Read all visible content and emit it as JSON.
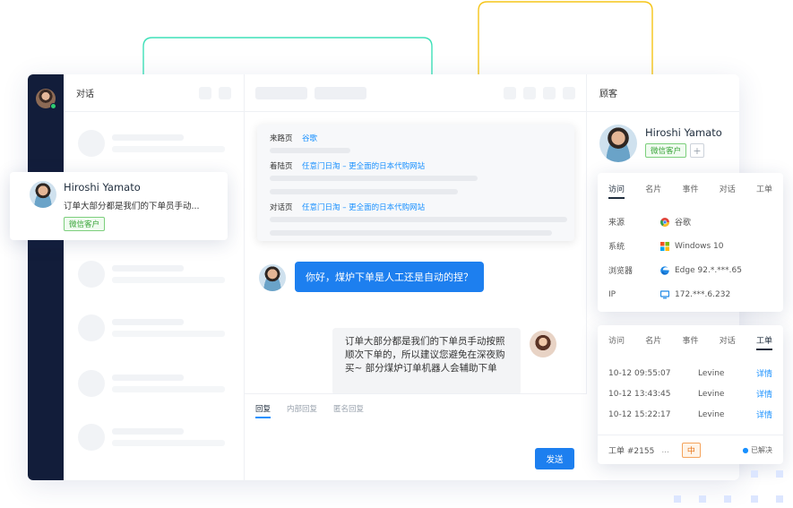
{
  "conversation_panel": {
    "title": "对话"
  },
  "customer_panel": {
    "title": "顾客"
  },
  "customer": {
    "name": "Hiroshi Yamato",
    "tag": "微信客户",
    "add": "+"
  },
  "popup_card": {
    "name": "Hiroshi Yamato",
    "preview": "订单大部分都是我们的下单员手动...",
    "tag": "微信客户"
  },
  "visit_info": {
    "rows": [
      {
        "label": "来路页",
        "value": "谷歌"
      },
      {
        "label": "着陆页",
        "value": "任意门日淘 – 更全面的日本代购网站"
      },
      {
        "label": "对话页",
        "value": "任意门日淘 – 更全面的日本代购网站"
      }
    ]
  },
  "messages": {
    "incoming": "你好，煤炉下单是人工还是自动的捏？",
    "outgoing": "订单大部分都是我们的下单员手动按照顺次下单的，所以建议您避免在深夜购买~ 部分煤炉订单机器人会辅助下单"
  },
  "composer": {
    "tabs": [
      "回复",
      "内部回复",
      "匿名回复"
    ],
    "send": "发送"
  },
  "visit_card": {
    "tabs": [
      "访问",
      "名片",
      "事件",
      "对话",
      "工单"
    ],
    "rows": [
      {
        "label": "来源",
        "value": "谷歌",
        "icon": "chrome-icon"
      },
      {
        "label": "系统",
        "value": "Windows 10",
        "icon": "windows-icon"
      },
      {
        "label": "浏览器",
        "value": "Edge 92.*.***.65",
        "icon": "edge-icon"
      },
      {
        "label": "IP",
        "value": "172.***.6.232",
        "icon": "monitor-icon"
      }
    ]
  },
  "ticket_card": {
    "tabs": [
      "访问",
      "名片",
      "事件",
      "对话",
      "工单"
    ],
    "rows": [
      {
        "time": "10-12 09:55:07",
        "agent": "Levine",
        "link": "详情"
      },
      {
        "time": "10-12 13:43:45",
        "agent": "Levine",
        "link": "详情"
      },
      {
        "time": "10-12 15:22:17",
        "agent": "Levine",
        "link": "详情"
      }
    ],
    "ticket": {
      "id": "工单 #2155",
      "ellipsis": "...",
      "priority": "中",
      "status": "已解决"
    }
  },
  "colors": {
    "accent": "#1d7fef",
    "rail": "#121d3a",
    "wire_green": "#3ee0b8",
    "wire_yellow": "#f5c518"
  }
}
